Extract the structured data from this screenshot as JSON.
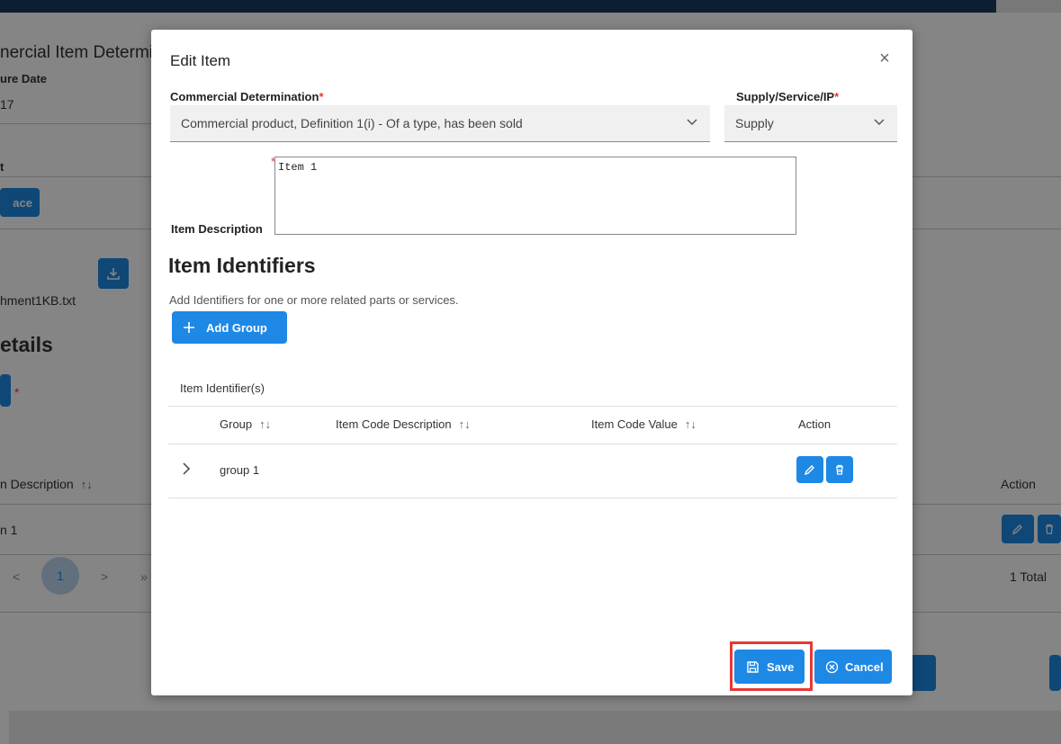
{
  "background": {
    "title_partial": "nercial Item Determi",
    "date_label_partial": "ure Date",
    "date_value_partial": "17",
    "section_label_partial": "t",
    "replace_button_partial": "ace",
    "attachment_partial": "hment1KB.txt",
    "details_heading_partial": "etails",
    "required_mark": "*",
    "col_item_description_partial": "n Description",
    "col_action": "Action",
    "row_item_partial": "n 1",
    "pager_current": "1",
    "pager_prev": "<",
    "pager_next": ">",
    "pager_last": "»",
    "total_text": "1 Total"
  },
  "modal": {
    "title": "Edit Item",
    "commercial_determination": {
      "label": "Commercial Determination",
      "required": "*",
      "value": "Commercial product, Definition 1(i) - Of a type, has been sold"
    },
    "supply_service_ip": {
      "label": "Supply/Service/IP",
      "required": "*",
      "value": "Supply"
    },
    "item_description": {
      "label": "Item Description",
      "required": "*",
      "value": "Item 1"
    },
    "identifiers": {
      "heading": "Item Identifiers",
      "helper": "Add Identifiers for one or more related parts or services.",
      "add_group_label": "Add Group",
      "table_caption": "Item Identifier(s)",
      "columns": {
        "group": "Group",
        "item_code_description": "Item Code Description",
        "item_code_value": "Item Code Value",
        "action": "Action"
      },
      "sort_glyph": "↑↓",
      "rows": [
        {
          "group": "group 1",
          "item_code_description": "",
          "item_code_value": ""
        }
      ]
    },
    "save_label": "Save",
    "cancel_label": "Cancel"
  },
  "colors": {
    "primary": "#1e88e5",
    "required": "#e53935",
    "highlight": "#e53935",
    "header_navy": "#1a3a63"
  }
}
